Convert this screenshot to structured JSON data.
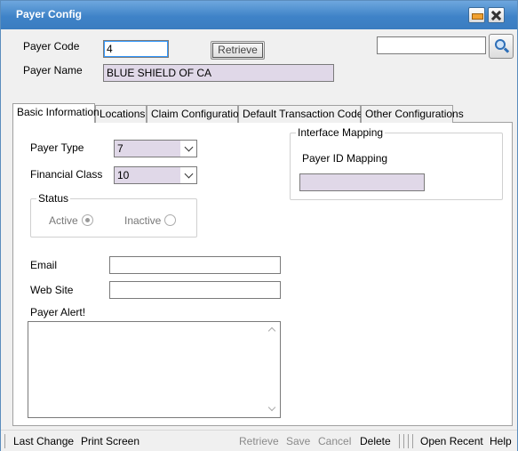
{
  "window": {
    "title": "Payer Config",
    "minimize_icon": "minimize-icon",
    "close_icon": "close-icon"
  },
  "header": {
    "payer_code_label": "Payer Code",
    "payer_code_value": "4",
    "retrieve_label": "Retrieve",
    "payer_name_label": "Payer Name",
    "payer_name_value": "BLUE SHIELD OF CA",
    "search_value": "",
    "search_icon": "search-icon"
  },
  "tabs": [
    {
      "label": "Basic Information",
      "active": true
    },
    {
      "label": "Locations"
    },
    {
      "label": "Claim Configuration"
    },
    {
      "label": "Default Transaction Codes"
    },
    {
      "label": "Other Configurations"
    }
  ],
  "basic": {
    "payer_type_label": "Payer Type",
    "payer_type_value": "7",
    "financial_class_label": "Financial Class",
    "financial_class_value": "10",
    "status_legend": "Status",
    "active_label": "Active",
    "inactive_label": "Inactive",
    "status_selected": "Active",
    "email_label": "Email",
    "email_value": "",
    "website_label": "Web Site",
    "website_value": "",
    "payer_alert_label": "Payer Alert!",
    "payer_alert_value": ""
  },
  "interface_mapping": {
    "legend": "Interface Mapping",
    "payer_id_label": "Payer ID Mapping",
    "payer_id_value": ""
  },
  "statusbar": {
    "last_change": "Last Change",
    "print_screen": "Print Screen",
    "retrieve": "Retrieve",
    "save": "Save",
    "cancel": "Cancel",
    "delete": "Delete",
    "open_recent": "Open Recent",
    "help": "Help"
  },
  "colors": {
    "titlebar": "#3f83c8",
    "readonly_field": "#e0d8e8"
  }
}
